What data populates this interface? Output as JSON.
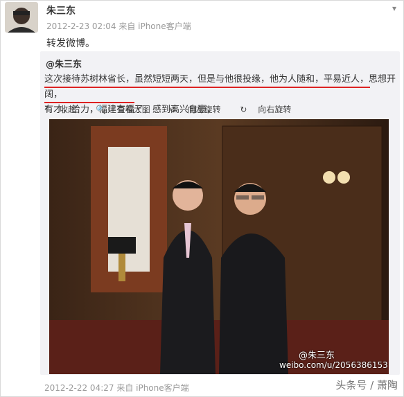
{
  "post": {
    "username": "朱三东",
    "meta": "2012-2-23 02:04 来自 iPhone客户端",
    "text": "转发微博。"
  },
  "repost": {
    "username": "@朱三东",
    "text_line1": "这次接待苏树林省长，虽然短短两天，但是与他很投缘，他为人随和，平易近人，思想开阔，",
    "text_line2": "有才，给力，福建有福了，感到高兴自豪，",
    "actions": [
      "收起",
      "查看大图",
      "向左旋转",
      "向右旋转"
    ],
    "watermark_name": "@朱三东",
    "watermark_url": "weibo.com/u/2056386153"
  },
  "footer": {
    "meta": "2012-2-22 04:27 来自 iPhone客户端",
    "brand": "头条号 / 萧陶"
  },
  "icons": {
    "collapse": "arrow-up-icon",
    "zoom": "magnifier-icon",
    "rotate_left": "rotate-left-icon",
    "rotate_right": "rotate-right-icon",
    "menu": "chevron-down-icon"
  }
}
